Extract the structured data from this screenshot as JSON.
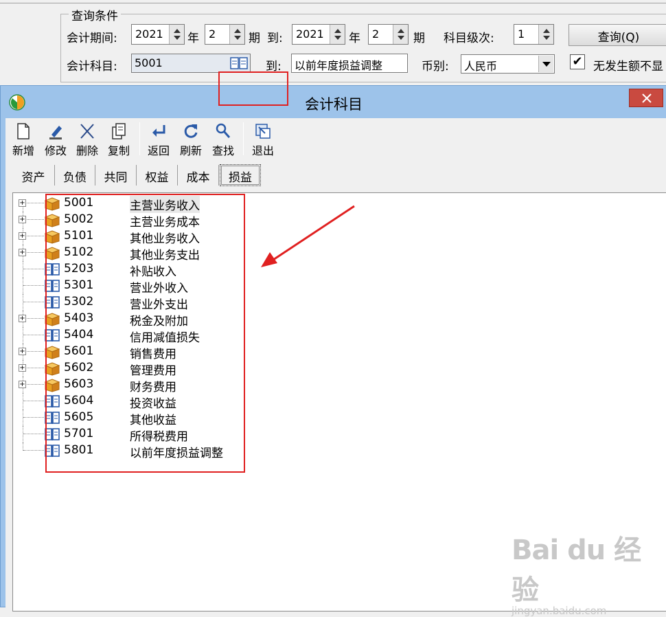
{
  "query": {
    "group_title": "查询条件",
    "period_label": "会计期间:",
    "year_from": "2021",
    "year_unit": "年",
    "period_from": "2",
    "period_unit": "期",
    "to_label": "到:",
    "year_to": "2021",
    "period_to": "2",
    "level_label": "科目级次:",
    "level_value": "1",
    "query_button": "查询(Q)",
    "account_label": "会计科目:",
    "account_from": "5001",
    "account_to": "以前年度损益调整",
    "currency_label": "币别:",
    "currency_value": "人民币",
    "no_amount_label": "无发生额不显",
    "no_amount_checked": true
  },
  "dialog": {
    "title": "会计科目",
    "close_glyph": "✕",
    "toolbar": [
      {
        "label": "新增",
        "icon": "new-file-icon"
      },
      {
        "label": "修改",
        "icon": "edit-icon"
      },
      {
        "label": "删除",
        "icon": "delete-icon"
      },
      {
        "label": "复制",
        "icon": "copy-icon"
      },
      {
        "label": "返回",
        "icon": "return-icon"
      },
      {
        "label": "刷新",
        "icon": "refresh-icon"
      },
      {
        "label": "查找",
        "icon": "search-icon"
      },
      {
        "label": "退出",
        "icon": "exit-icon"
      }
    ],
    "tabs": [
      "资产",
      "负债",
      "共同",
      "权益",
      "成本",
      "损益"
    ],
    "active_tab": "损益",
    "accounts": [
      {
        "code": "5001",
        "name": "主营业务收入",
        "type": "folder",
        "expandable": true
      },
      {
        "code": "5002",
        "name": "主营业务成本",
        "type": "folder",
        "expandable": true
      },
      {
        "code": "5101",
        "name": "其他业务收入",
        "type": "folder",
        "expandable": true
      },
      {
        "code": "5102",
        "name": "其他业务支出",
        "type": "folder",
        "expandable": true
      },
      {
        "code": "5203",
        "name": "补贴收入",
        "type": "book",
        "expandable": false
      },
      {
        "code": "5301",
        "name": "营业外收入",
        "type": "book",
        "expandable": false
      },
      {
        "code": "5302",
        "name": "营业外支出",
        "type": "book",
        "expandable": false
      },
      {
        "code": "5403",
        "name": "税金及附加",
        "type": "folder",
        "expandable": true
      },
      {
        "code": "5404",
        "name": "信用减值损失",
        "type": "book",
        "expandable": false
      },
      {
        "code": "5601",
        "name": "销售费用",
        "type": "folder",
        "expandable": true
      },
      {
        "code": "5602",
        "name": "管理费用",
        "type": "folder",
        "expandable": true
      },
      {
        "code": "5603",
        "name": "财务费用",
        "type": "folder",
        "expandable": true
      },
      {
        "code": "5604",
        "name": "投资收益",
        "type": "book",
        "expandable": false
      },
      {
        "code": "5605",
        "name": "其他收益",
        "type": "book",
        "expandable": false
      },
      {
        "code": "5701",
        "name": "所得税费用",
        "type": "book",
        "expandable": false
      },
      {
        "code": "5801",
        "name": "以前年度损益调整",
        "type": "book",
        "expandable": false
      }
    ],
    "expand_glyph": "+"
  },
  "watermark": {
    "brand": "Bai du 经验",
    "url": "jingyan.baidu.com"
  },
  "colors": {
    "dialog_frame": "#9dc3ea",
    "close_button": "#c94a40",
    "highlight_box": "#e02020",
    "folder_icon": "#e8a020",
    "book_icon": "#2a5aa8"
  }
}
